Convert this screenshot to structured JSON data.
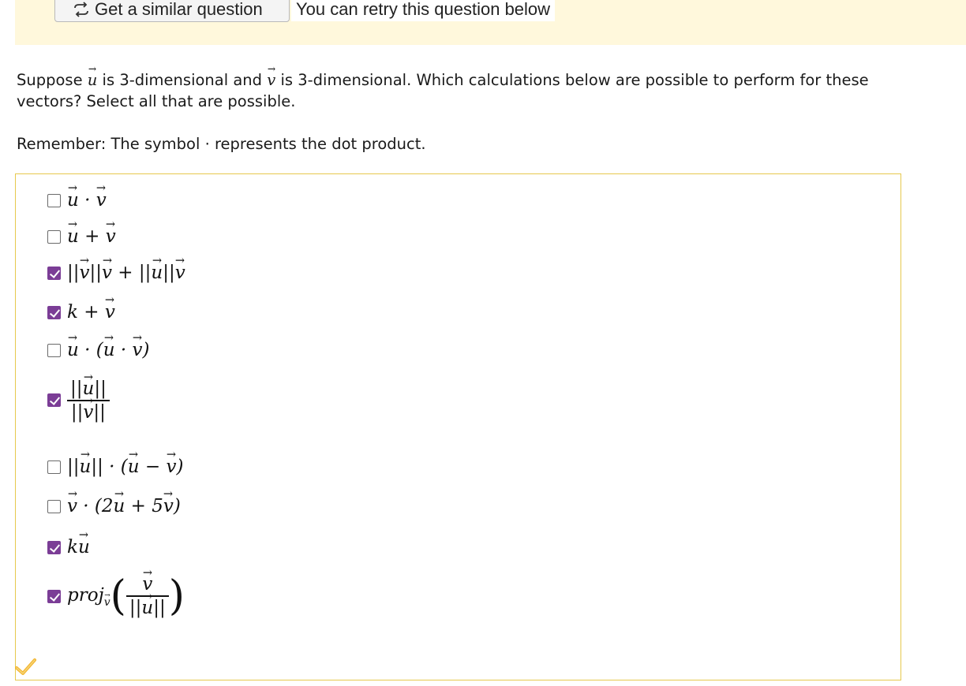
{
  "banner": {
    "similar_button_label": "Get a similar question",
    "retry_note": "You can retry this question below"
  },
  "question": {
    "part1": "Suppose ",
    "u": "u",
    "part2": " is 3-dimensional and ",
    "v": "v",
    "part3": " is 3-dimensional. Which calculations below are possible to perform for these vectors? Select all that are possible."
  },
  "reminder": {
    "before": "Remember: The symbol ",
    "symbol": "·",
    "after": " represents the dot product."
  },
  "options": [
    {
      "text": "u · v",
      "checked": false
    },
    {
      "text": "u + v",
      "checked": false
    },
    {
      "text": "||v||v + ||u||v",
      "checked": true
    },
    {
      "text": "k + v",
      "checked": true
    },
    {
      "text": "u · (u · v)",
      "checked": false
    },
    {
      "text": "||u|| / ||v||",
      "checked": true
    },
    {
      "text": "||u|| · (u − v)",
      "checked": false
    },
    {
      "text": "v · (2u + 5v)",
      "checked": false
    },
    {
      "text": "ku",
      "checked": true
    },
    {
      "text": "proj_v ( v / ||u|| )",
      "checked": true
    }
  ],
  "colors": {
    "banner_bg": "#fff8dc",
    "answer_border": "#e6c84d",
    "checkbox_checked": "#7b3d96",
    "correct_mark": "#f2b632"
  },
  "icons": {
    "similar": "refresh-arrows-icon",
    "status": "correct-check-icon"
  }
}
